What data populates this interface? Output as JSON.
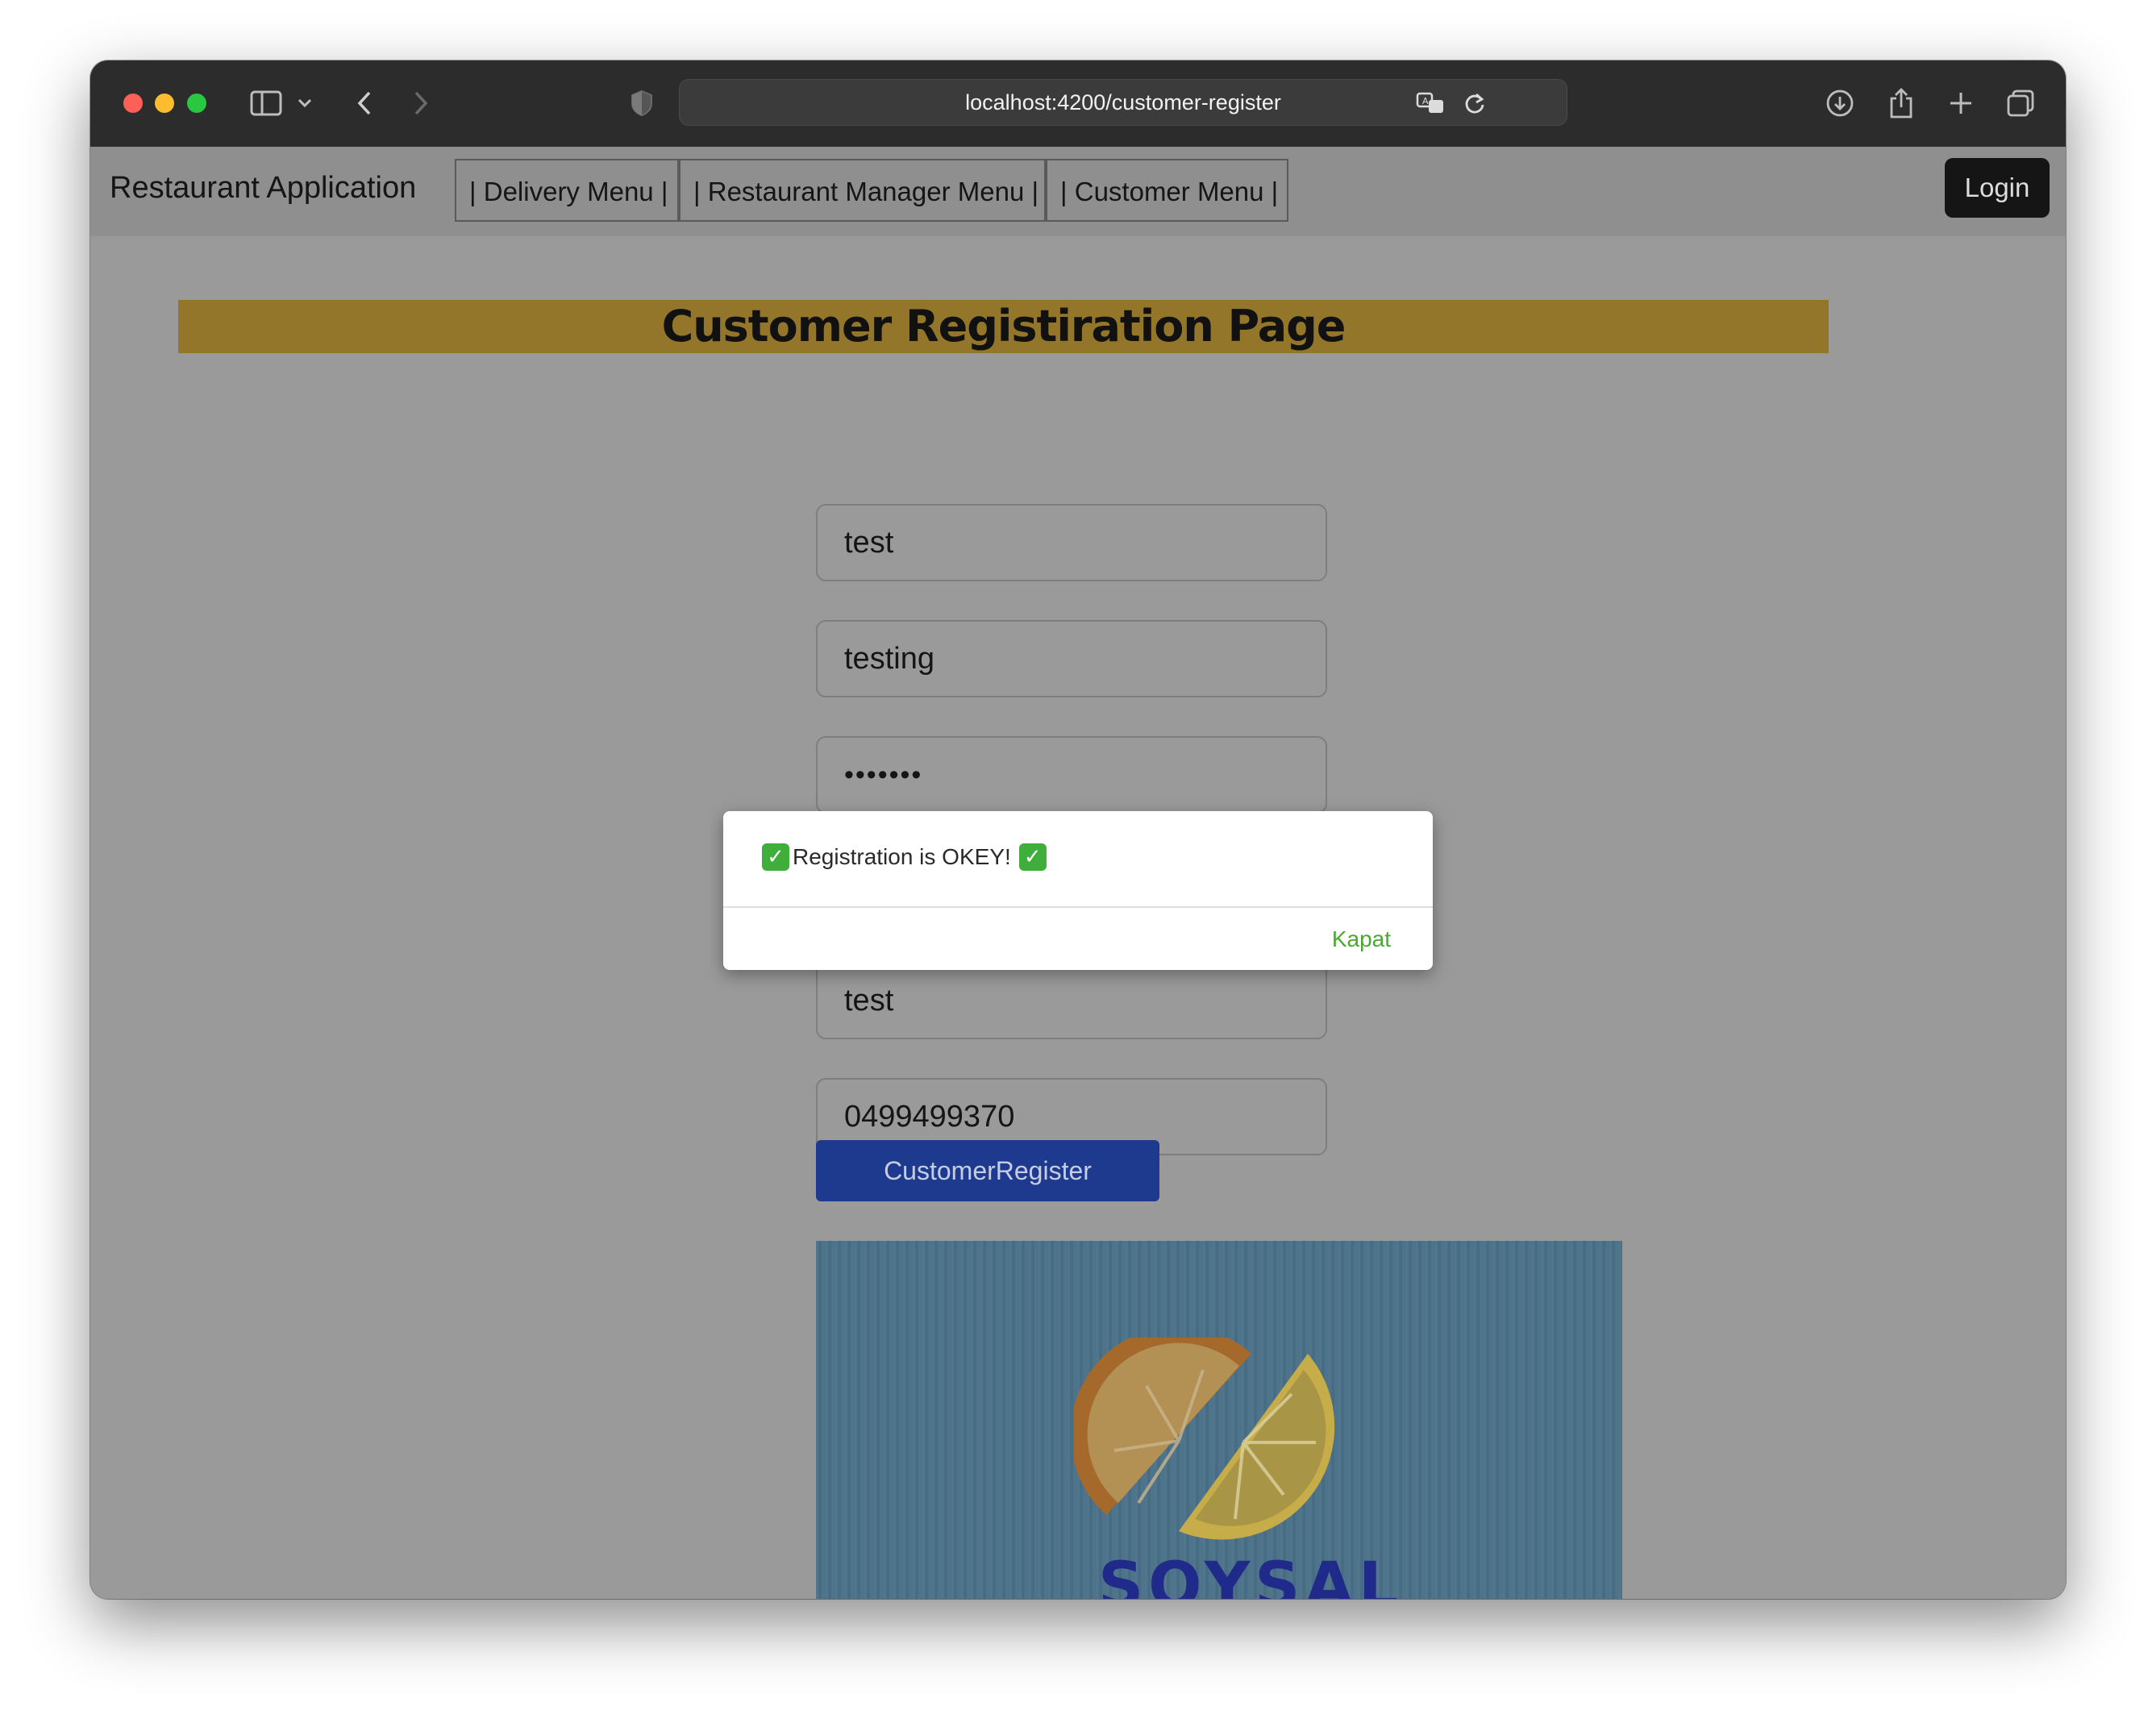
{
  "browser": {
    "url": "localhost:4200/customer-register"
  },
  "navbar": {
    "brand": "Restaurant Application",
    "items": [
      {
        "label": "| Delivery Menu |"
      },
      {
        "label": "| Restaurant Manager Menu |"
      },
      {
        "label": "| Customer Menu |"
      }
    ],
    "login_label": "Login"
  },
  "page": {
    "title": "Customer Registiration Page",
    "fields": [
      {
        "value": "test"
      },
      {
        "value": "testing"
      },
      {
        "value": "•••••••"
      },
      {
        "value": "test"
      },
      {
        "value": "0499499370"
      }
    ],
    "submit_label": "CustomerRegister",
    "banner_text": "SOYSAL"
  },
  "dialog": {
    "message": "Registration is OKEY!",
    "check_glyph": "✓",
    "close_label": "Kapat"
  },
  "colors": {
    "title_bar": "#94762a",
    "submit_button": "#1e3a8e",
    "dialog_close": "#4aa832",
    "check_badge": "#3fae3a"
  }
}
